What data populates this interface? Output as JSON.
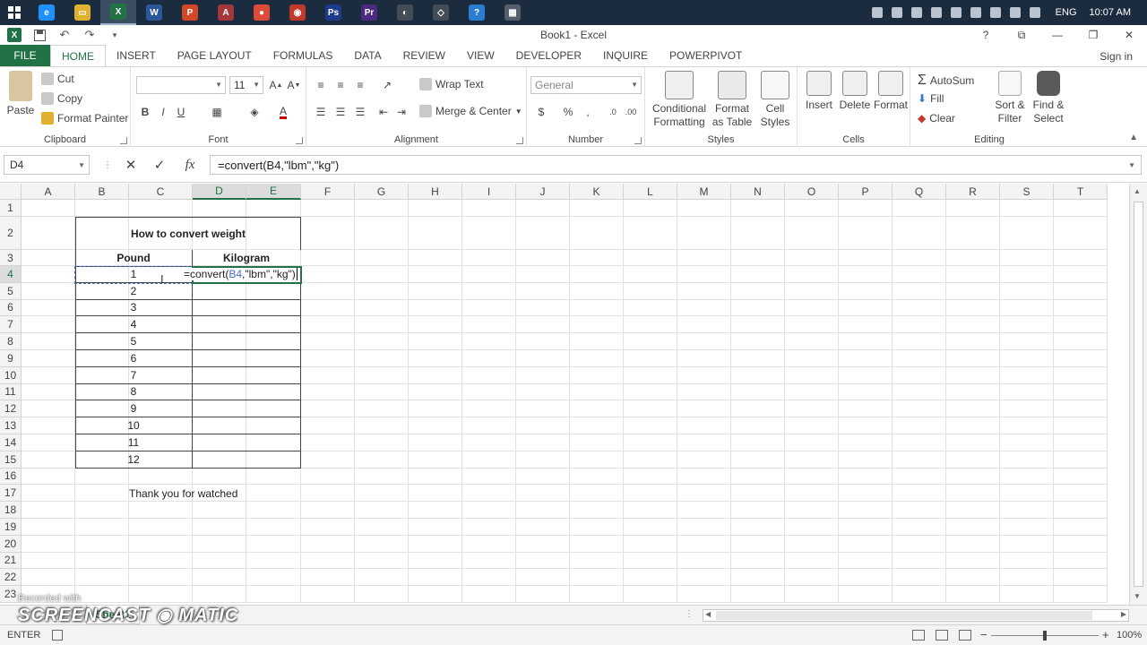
{
  "taskbar": {
    "apps": [
      {
        "name": "ie-icon",
        "glyph": "e",
        "color": "#1e90ff"
      },
      {
        "name": "file-explorer-icon",
        "glyph": "▭",
        "color": "#e0b030"
      },
      {
        "name": "excel-icon",
        "glyph": "X",
        "color": "#217346",
        "active": true
      },
      {
        "name": "word-icon",
        "glyph": "W",
        "color": "#2b579a"
      },
      {
        "name": "powerpoint-icon",
        "glyph": "P",
        "color": "#d24726"
      },
      {
        "name": "access-icon",
        "glyph": "A",
        "color": "#a4373a"
      },
      {
        "name": "chrome-icon",
        "glyph": "●",
        "color": "#dd4b39"
      },
      {
        "name": "screenrecorder-icon",
        "glyph": "◉",
        "color": "#c0392b"
      },
      {
        "name": "photoshop-icon",
        "glyph": "Ps",
        "color": "#1f3b8f"
      },
      {
        "name": "premiere-icon",
        "glyph": "Pr",
        "color": "#4b2a80"
      },
      {
        "name": "app-icon",
        "glyph": "◐",
        "color": "#444c56"
      },
      {
        "name": "app2-icon",
        "glyph": "◇",
        "color": "#444c56"
      },
      {
        "name": "help-icon",
        "glyph": "?",
        "color": "#2b7cd3"
      },
      {
        "name": "calculator-icon",
        "glyph": "▦",
        "color": "#555e6a"
      }
    ],
    "language": "ENG",
    "time": "10:07 AM"
  },
  "titlebar": {
    "title": "Book1 - Excel",
    "help": "?",
    "restore": "⧉",
    "minimize": "—",
    "maximize": "❐",
    "close": "✕"
  },
  "ribbon_tabs": [
    "FILE",
    "HOME",
    "INSERT",
    "PAGE LAYOUT",
    "FORMULAS",
    "DATA",
    "REVIEW",
    "VIEW",
    "DEVELOPER",
    "INQUIRE",
    "POWERPIVOT"
  ],
  "active_tab": "HOME",
  "sign_in": "Sign in",
  "ribbon": {
    "clipboard": {
      "label": "Clipboard",
      "paste": "Paste",
      "cut": "Cut",
      "copy": "Copy",
      "format_painter": "Format Painter"
    },
    "font": {
      "label": "Font",
      "font_name": "",
      "font_size": "11",
      "bold": "B",
      "italic": "I",
      "underline": "U"
    },
    "alignment": {
      "label": "Alignment",
      "wrap_text": "Wrap Text",
      "merge_center": "Merge & Center"
    },
    "number": {
      "label": "Number",
      "format": "General",
      "currency": "$",
      "percent": "%",
      "comma": ","
    },
    "styles": {
      "label": "Styles",
      "conditional": "Conditional Formatting",
      "format_table": "Format as Table",
      "cell_styles": "Cell Styles"
    },
    "cells": {
      "label": "Cells",
      "insert": "Insert",
      "delete": "Delete",
      "format": "Format"
    },
    "editing": {
      "label": "Editing",
      "autosum": "AutoSum",
      "fill": "Fill",
      "clear": "Clear",
      "sort_filter": "Sort & Filter",
      "find_select": "Find & Select"
    }
  },
  "formula_bar": {
    "name_box": "D4",
    "cancel": "✕",
    "enter": "✓",
    "fx": "fx",
    "formula": "=convert(B4,\"lbm\",\"kg\")"
  },
  "grid": {
    "columns": [
      "A",
      "B",
      "C",
      "D",
      "E",
      "F",
      "G",
      "H",
      "I",
      "J",
      "K",
      "L",
      "M",
      "N",
      "O",
      "P",
      "Q",
      "R",
      "S",
      "T"
    ],
    "rows": [
      "1",
      "2",
      "3",
      "4",
      "5",
      "6",
      "7",
      "8",
      "9",
      "10",
      "11",
      "12",
      "13",
      "14",
      "15",
      "16",
      "17",
      "18",
      "19",
      "20",
      "21",
      "22",
      "23"
    ],
    "selected_row": "4",
    "table_title": "How to convert weight",
    "header_pound": "Pound",
    "header_kilogram": "Kilogram",
    "pounds": [
      "1",
      "2",
      "3",
      "4",
      "5",
      "6",
      "7",
      "8",
      "9",
      "10",
      "11",
      "12"
    ],
    "thanks": "Thank you for watched",
    "edit_prefix": "=convert(",
    "edit_ref": "B4",
    "edit_suffix": ",\"lbm\",\"kg\")"
  },
  "sheet": {
    "tab": "Sheet1"
  },
  "status": {
    "mode": "ENTER",
    "zoom": "100%"
  },
  "watermark": {
    "small": "Recorded with",
    "big": "SCREENCAST ◉ MATIC"
  }
}
